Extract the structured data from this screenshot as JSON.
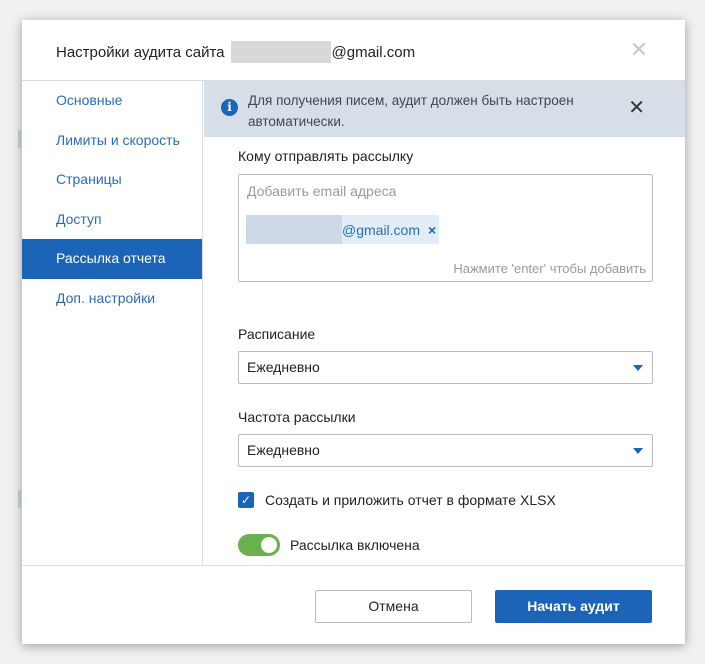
{
  "dialog": {
    "title_prefix": "Настройки аудита сайта",
    "title_suffix": "@gmail.com",
    "close_icon": "close-icon"
  },
  "sidebar": {
    "items": [
      {
        "label": "Основные"
      },
      {
        "label": "Лимиты и скорость"
      },
      {
        "label": "Страницы"
      },
      {
        "label": "Доступ"
      },
      {
        "label": "Рассылка отчета",
        "active": true
      },
      {
        "label": "Доп. настройки"
      }
    ]
  },
  "info": {
    "icon": "info-icon",
    "text": "Для получения писем, аудит должен быть настроен автоматически."
  },
  "recipients": {
    "label": "Кому отправлять рассылку",
    "placeholder": "Добавить email адреса",
    "chip_text": "@gmail.com",
    "chip_remove": "×",
    "hint": "Нажмите 'enter' чтобы добавить"
  },
  "schedule": {
    "label": "Расписание",
    "value": "Ежедневно"
  },
  "frequency": {
    "label": "Частота рассылки",
    "value": "Ежедневно"
  },
  "attach_xlsx": {
    "label": "Создать и приложить отчет в формате XLSX",
    "checked": true
  },
  "mailing_toggle": {
    "label": "Рассылка включена",
    "on": true
  },
  "footer": {
    "cancel_label": "Отмена",
    "start_label": "Начать аудит"
  },
  "colors": {
    "accent": "#1b64b8",
    "toggle_on": "#6ab04c",
    "info_bg": "#d6dee7"
  }
}
